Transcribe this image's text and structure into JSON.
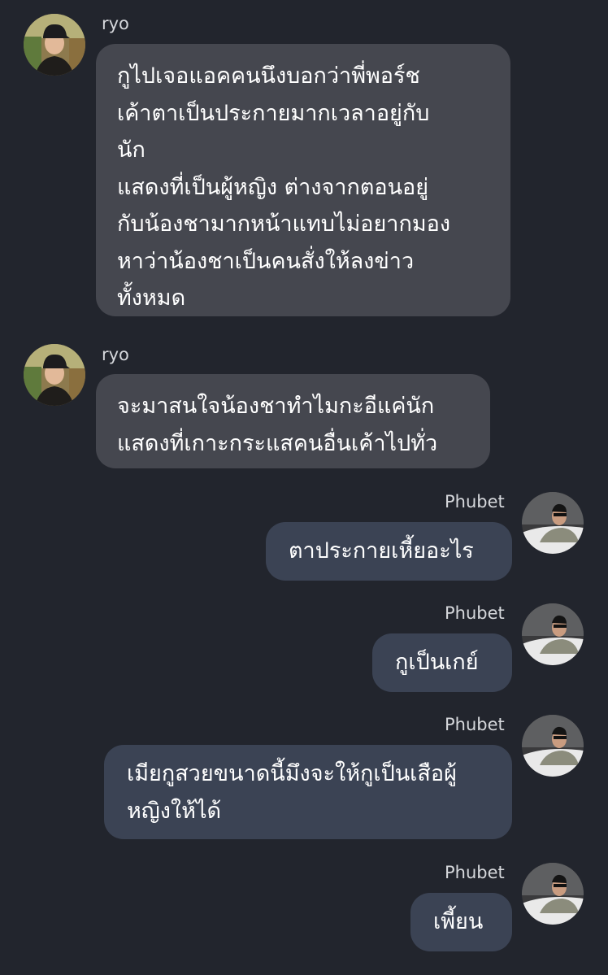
{
  "conversation": {
    "messages": [
      {
        "sender": "ryo",
        "direction": "incoming",
        "text": "กูไปเจอแอคคนนึงบอกว่าพี่พอร์ช\nเค้าตาเป็นประกายมากเวลาอยู่กับ\nนัก\nแสดงที่เป็นผู้หญิง ต่างจากตอนอยู่\nกับน้องชามากหน้าแทบไม่อยากมอง\nหาว่าน้องชาเป็นคนสั่งให้ลงข่าว\nทั้งหมด"
      },
      {
        "sender": "ryo",
        "direction": "incoming",
        "text": "จะมาสนใจน้องชาทำไมกะอีแค่นัก\nแสดงที่เกาะกระแสคนอื่นเค้าไปทั่ว"
      },
      {
        "sender": "Phubet",
        "direction": "outgoing",
        "text": "ตาประกายเหี้ยอะไร"
      },
      {
        "sender": "Phubet",
        "direction": "outgoing",
        "text": "กูเป็นเกย์"
      },
      {
        "sender": "Phubet",
        "direction": "outgoing",
        "text": "เมียกูสวยขนาดนี้มึงจะให้กูเป็นเสือผู้\nหญิงให้ได้"
      },
      {
        "sender": "Phubet",
        "direction": "outgoing",
        "text": "เพี้ยน"
      }
    ]
  },
  "colors": {
    "background": "#22252d",
    "incoming_bubble": "#45474f",
    "outgoing_bubble": "#3b4354",
    "sender_name": "#d6d8dc",
    "message_text": "#ffffff"
  },
  "icons": {
    "ryo_avatar": "avatar-photo-man-cap",
    "phubet_avatar": "avatar-photo-man-car"
  }
}
